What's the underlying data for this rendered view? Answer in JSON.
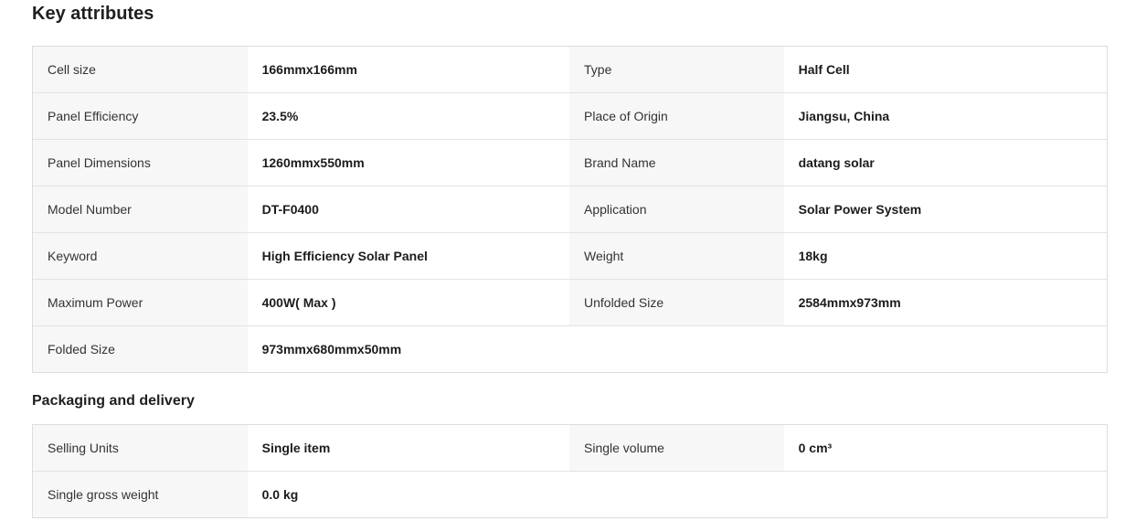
{
  "key_attributes": {
    "title": "Key attributes",
    "rows": [
      {
        "l1": "Cell size",
        "v1": "166mmx166mm",
        "l2": "Type",
        "v2": "Half Cell"
      },
      {
        "l1": "Panel Efficiency",
        "v1": "23.5%",
        "l2": "Place of Origin",
        "v2": "Jiangsu, China"
      },
      {
        "l1": "Panel Dimensions",
        "v1": "1260mmx550mm",
        "l2": "Brand Name",
        "v2": "datang solar"
      },
      {
        "l1": "Model Number",
        "v1": "DT-F0400",
        "l2": "Application",
        "v2": "Solar Power System"
      },
      {
        "l1": "Keyword",
        "v1": "High Efficiency Solar Panel",
        "l2": "Weight",
        "v2": "18kg"
      },
      {
        "l1": "Maximum Power",
        "v1": "400W( Max )",
        "l2": "Unfolded Size",
        "v2": "2584mmx973mm"
      },
      {
        "l1": "Folded Size",
        "v1": "973mmx680mmx50mm",
        "l2": "",
        "v2": ""
      }
    ]
  },
  "packaging": {
    "title": "Packaging and delivery",
    "rows": [
      {
        "l1": "Selling Units",
        "v1": "Single item",
        "l2": "Single volume",
        "v2": "0 cm³"
      },
      {
        "l1": "Single gross weight",
        "v1": "0.0 kg",
        "l2": "",
        "v2": ""
      }
    ]
  }
}
